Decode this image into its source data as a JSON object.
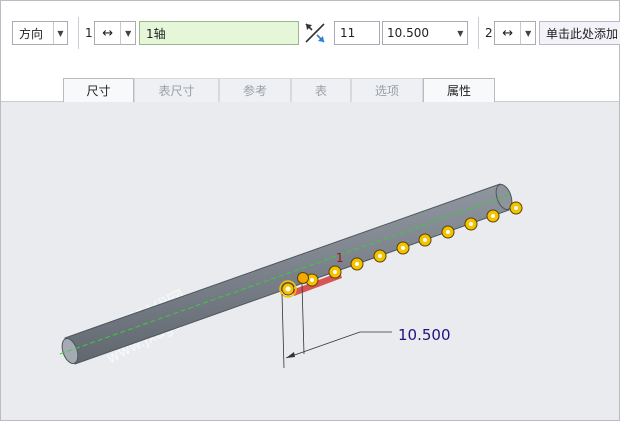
{
  "toolbar": {
    "direction_label": "方向",
    "ref1_index": "1",
    "ref1_type_icon": "↔",
    "ref1_value": "1轴",
    "count_value": "11",
    "spacing_value": "10.500",
    "ref2_index": "2",
    "ref2_type_icon": "↔",
    "add_item_label": "单击此处添加"
  },
  "tabs": [
    {
      "label": "尺寸"
    },
    {
      "label": "表尺寸"
    },
    {
      "label": "参考"
    },
    {
      "label": "表"
    },
    {
      "label": "选项"
    },
    {
      "label": "属性"
    }
  ],
  "viewport": {
    "dimension_label": "10.500",
    "marker_label": "1",
    "watermark_line1": "机械时代网",
    "watermark_line2": "www.jxage.com",
    "accent_color": "#f5c200",
    "shaft_color": "#7f868f"
  }
}
